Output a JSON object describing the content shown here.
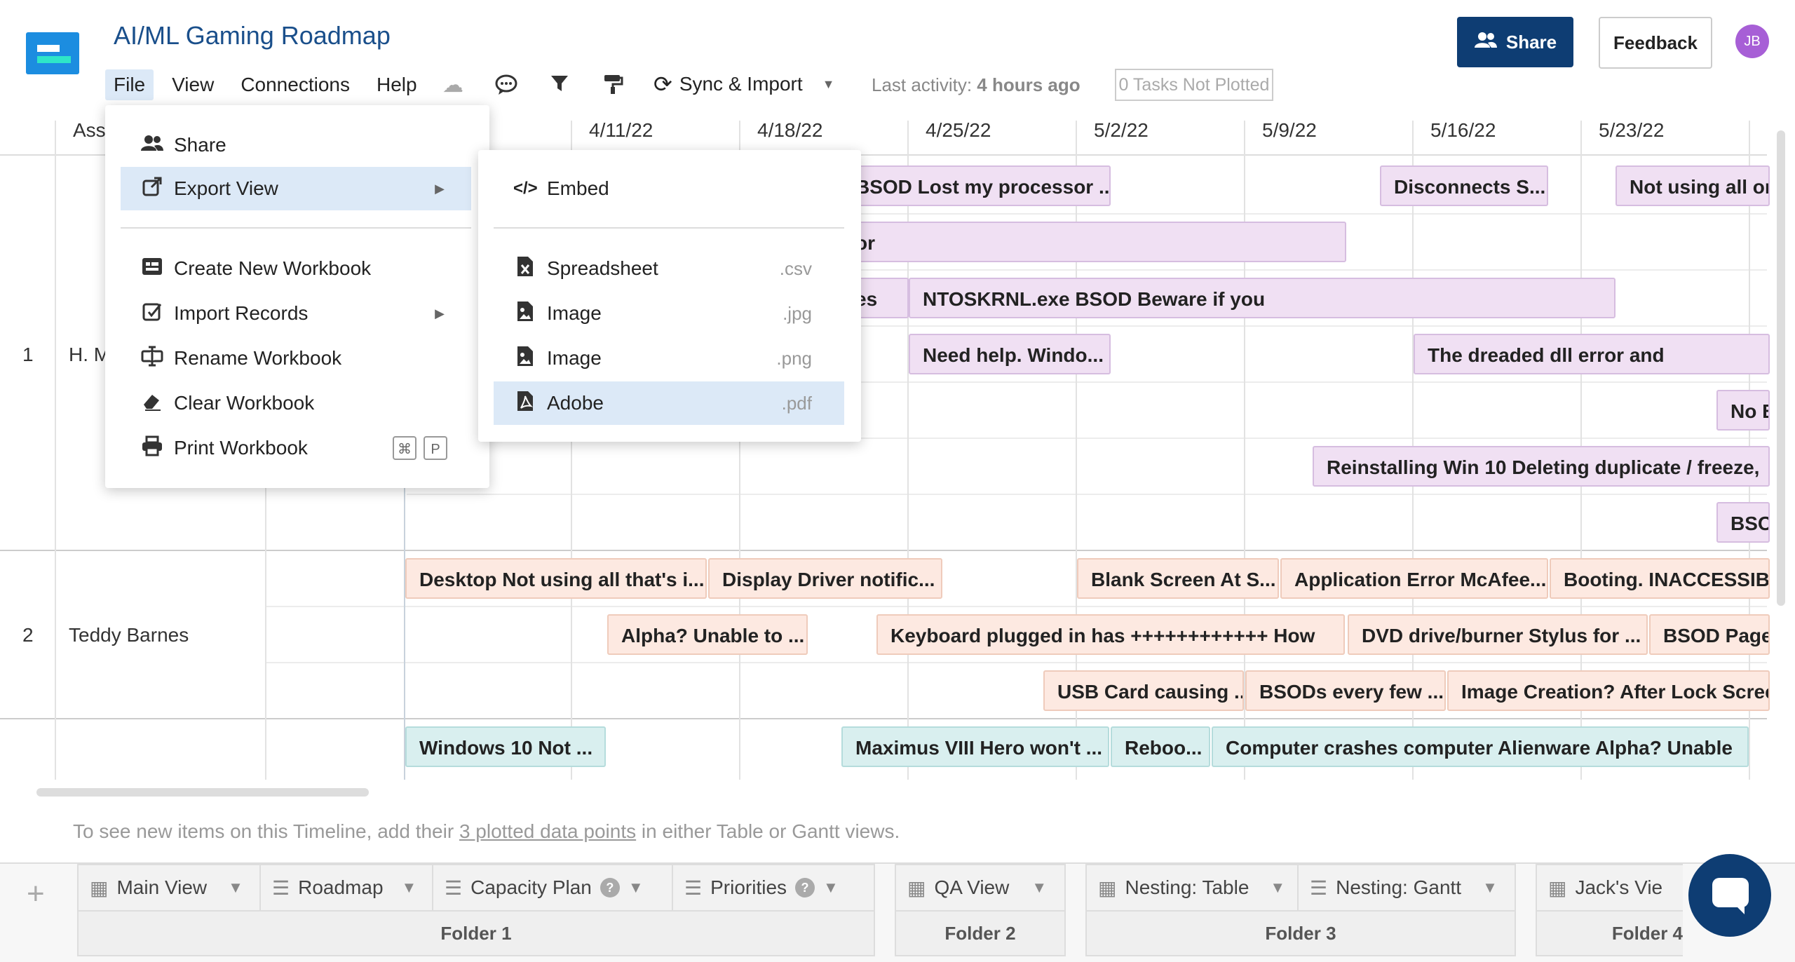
{
  "app": {
    "title": "AI/ML Gaming Roadmap",
    "avatar_initials": "JB",
    "share_label": "Share",
    "feedback_label": "Feedback"
  },
  "menubar": [
    "File",
    "View",
    "Connections",
    "Help"
  ],
  "toolbar": {
    "sync_label": "Sync & Import",
    "last_activity_label": "Last activity:",
    "last_activity_value": "4 hours ago",
    "tasks_not_plotted": "0 Tasks Not Plotted"
  },
  "grid": {
    "assignee_header": "Assi",
    "dates": [
      "4/11/22",
      "4/18/22",
      "4/25/22",
      "5/2/22",
      "5/9/22",
      "5/16/22",
      "5/23/22"
    ],
    "rows": [
      {
        "num": "1",
        "assignee": "H. M"
      },
      {
        "num": "2",
        "assignee": "Teddy Barnes"
      }
    ],
    "bars": [
      "BSOD Lost my processor ...",
      "Disconnects S...",
      "Not using all or r",
      "or",
      "es",
      "NTOSKRNL.exe BSOD Beware if you",
      "Need help. Windo...",
      "The dreaded dll error and",
      "No B",
      "Reinstalling Win 10 Deleting duplicate / freeze,",
      "BSO",
      "Desktop Not using all that's i...",
      "Display Driver notific...",
      "Blank Screen At S...",
      "Application Error McAfee...",
      "Booting. INACCESSIBLE",
      "Alpha? Unable to ...",
      "Keyboard plugged in has ++++++++++++ How",
      "DVD drive/burner Stylus for ...",
      "BSOD Page",
      "USB Card causing ...",
      "BSODs every few ...",
      "Image Creation? After Lock Screen",
      "Windows 10 Not ...",
      "Maximus VIII Hero won't ...",
      "Reboo...",
      "Computer crashes computer Alienware Alpha? Unable"
    ]
  },
  "footnote": {
    "before": "To see new items on this Timeline, add their ",
    "link": "3 plotted data points",
    "after": " in either Table or Gantt views."
  },
  "file_menu": {
    "items": [
      "Share",
      "Export View",
      "Create New Workbook",
      "Import Records",
      "Rename Workbook",
      "Clear Workbook",
      "Print Workbook"
    ],
    "print_shortcut": [
      "⌘",
      "P"
    ]
  },
  "export_menu": {
    "embed": "Embed",
    "items": [
      {
        "label": "Spreadsheet",
        "ext": ".csv"
      },
      {
        "label": "Image",
        "ext": ".jpg"
      },
      {
        "label": "Image",
        "ext": ".png"
      },
      {
        "label": "Adobe",
        "ext": ".pdf"
      }
    ]
  },
  "tabs": [
    "Main View",
    "Roadmap",
    "Capacity Plan",
    "Priorities",
    "QA View",
    "Nesting: Table",
    "Nesting: Gantt",
    "Jack's Vie"
  ],
  "folders": [
    "Folder 1",
    "Folder 2",
    "Folder 3",
    "Folder 4"
  ],
  "colors": {
    "brand": "#0e3d73",
    "highlight": "#dce9f7",
    "purple_bar": "#f0e0f3",
    "orange_bar": "#fde9e1",
    "teal_bar": "#d9efef"
  }
}
